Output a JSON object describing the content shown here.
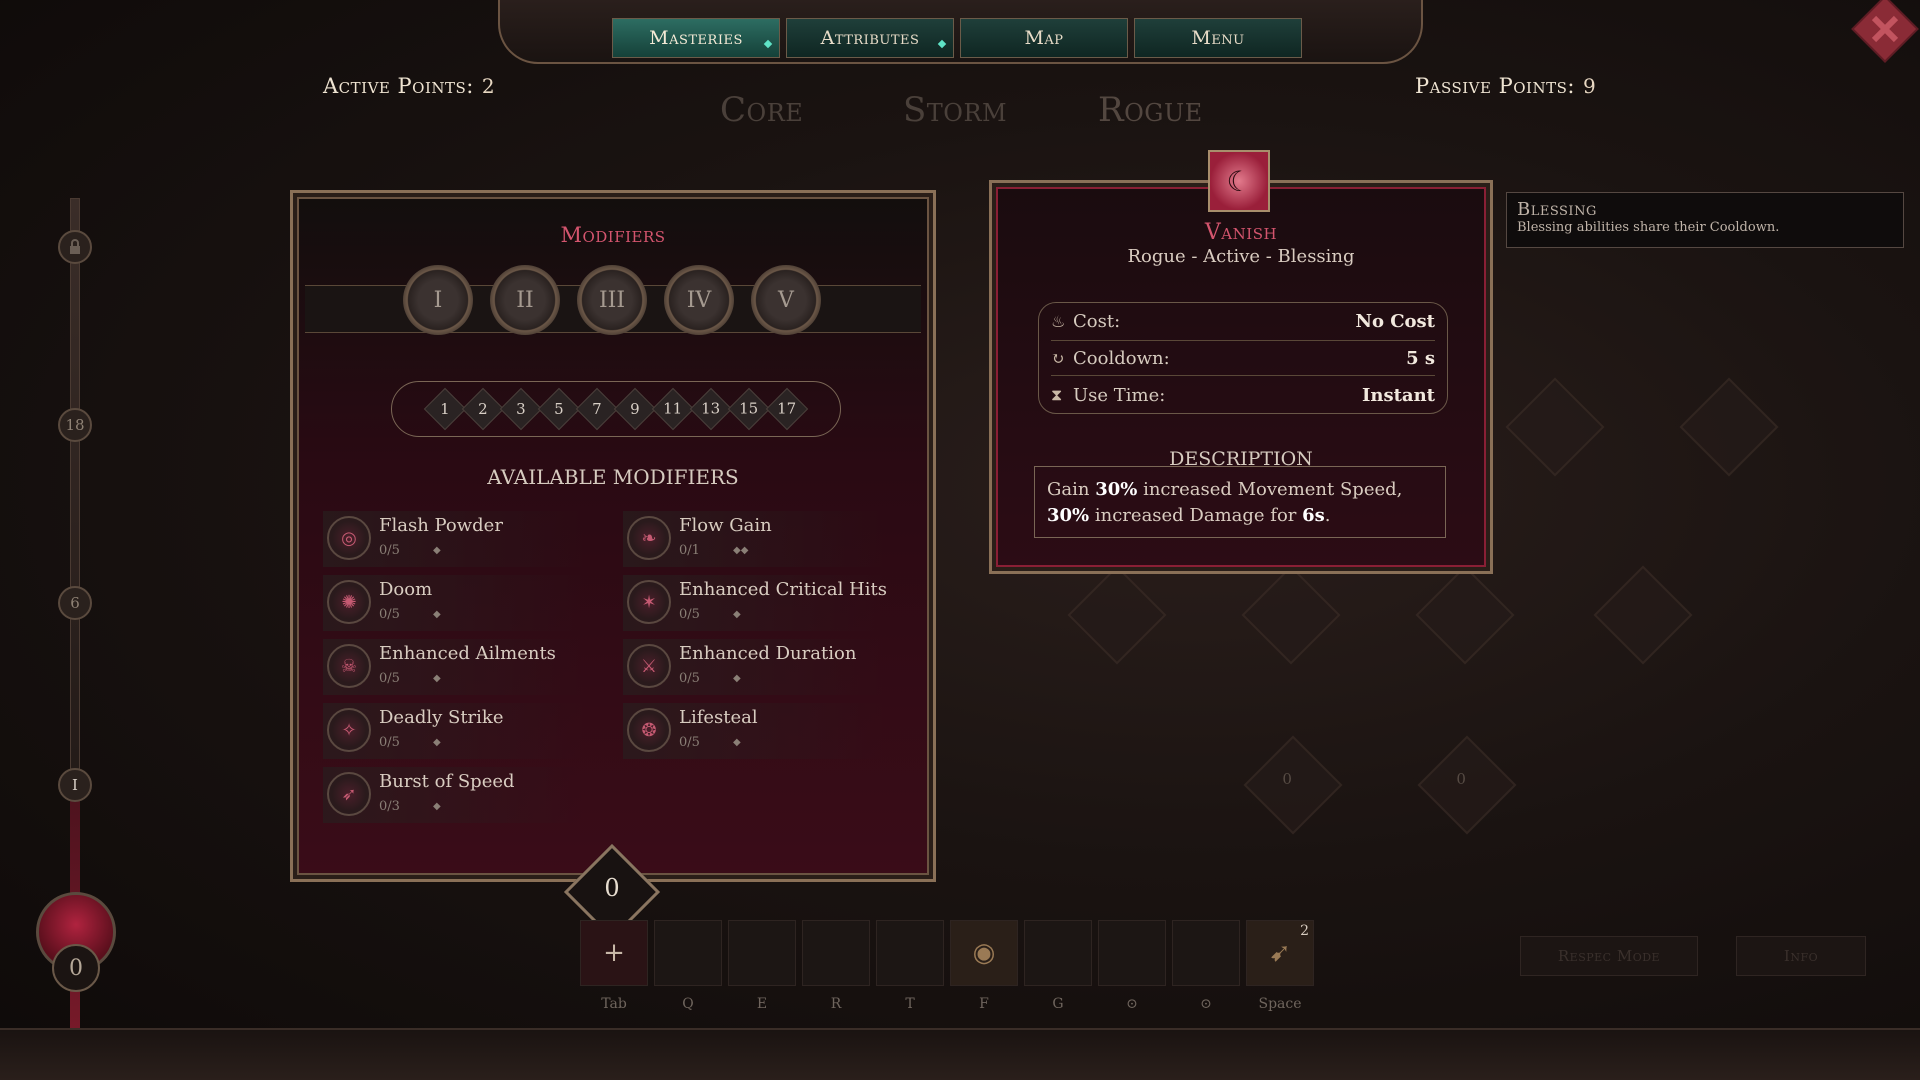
{
  "nav": {
    "tabs": [
      {
        "label": "Masteries"
      },
      {
        "label": "Attributes"
      },
      {
        "label": "Map"
      },
      {
        "label": "Menu"
      }
    ]
  },
  "points": {
    "active_label": "Active Points:",
    "active_value": "2",
    "passive_label": "Passive Points:",
    "passive_value": "9"
  },
  "class_tabs": [
    "Core",
    "Storm",
    "Rogue"
  ],
  "left_slider": {
    "nodes": [
      "",
      "18",
      "6",
      "I"
    ],
    "orb_value": "0"
  },
  "modifiers": {
    "title": "Modifiers",
    "tiers": [
      "I",
      "II",
      "III",
      "IV",
      "V"
    ],
    "levels": [
      "1",
      "2",
      "3",
      "5",
      "7",
      "9",
      "11",
      "13",
      "15",
      "17"
    ],
    "available_label": "AVAILABLE MODIFIERS",
    "items": [
      {
        "name": "Flash Powder",
        "count": "0/5",
        "diamonds": "◆"
      },
      {
        "name": "Flow Gain",
        "count": "0/1",
        "diamonds": "◆◆"
      },
      {
        "name": "Doom",
        "count": "0/5",
        "diamonds": "◆"
      },
      {
        "name": "Enhanced Critical Hits",
        "count": "0/5",
        "diamonds": "◆"
      },
      {
        "name": "Enhanced Ailments",
        "count": "0/5",
        "diamonds": "◆"
      },
      {
        "name": "Enhanced Duration",
        "count": "0/5",
        "diamonds": "◆"
      },
      {
        "name": "Deadly Strike",
        "count": "0/5",
        "diamonds": "◆"
      },
      {
        "name": "Lifesteal",
        "count": "0/5",
        "diamonds": "◆"
      },
      {
        "name": "Burst of Speed",
        "count": "0/3",
        "diamonds": "◆"
      }
    ],
    "counter": "0"
  },
  "skill": {
    "name": "Vanish",
    "tags": "Rogue - Active - Blessing",
    "stats": [
      {
        "icon": "cost-icon",
        "label": "Cost:",
        "value": "No Cost"
      },
      {
        "icon": "cooldown-icon",
        "label": "Cooldown:",
        "value": "5 s"
      },
      {
        "icon": "hourglass-icon",
        "label": "Use Time:",
        "value": "Instant"
      }
    ],
    "description_title": "DESCRIPTION",
    "description": {
      "p1": "Gain ",
      "b1": "30%",
      "p2": " increased Movement Speed, ",
      "b2": "30%",
      "p3": " increased Damage for ",
      "b3": "6s",
      "p4": "."
    }
  },
  "tooltip": {
    "title": "Blessing",
    "body": "Blessing abilities share their Cooldown."
  },
  "background_nodes": {
    "counts": [
      "0",
      "0"
    ]
  },
  "hotbar": {
    "keys": [
      "Tab",
      "Q",
      "E",
      "R",
      "T",
      "F",
      "G",
      "",
      "",
      "Space",
      ""
    ],
    "stack_count": "2",
    "ghost_buttons": [
      "Respec Mode",
      "Info"
    ]
  }
}
